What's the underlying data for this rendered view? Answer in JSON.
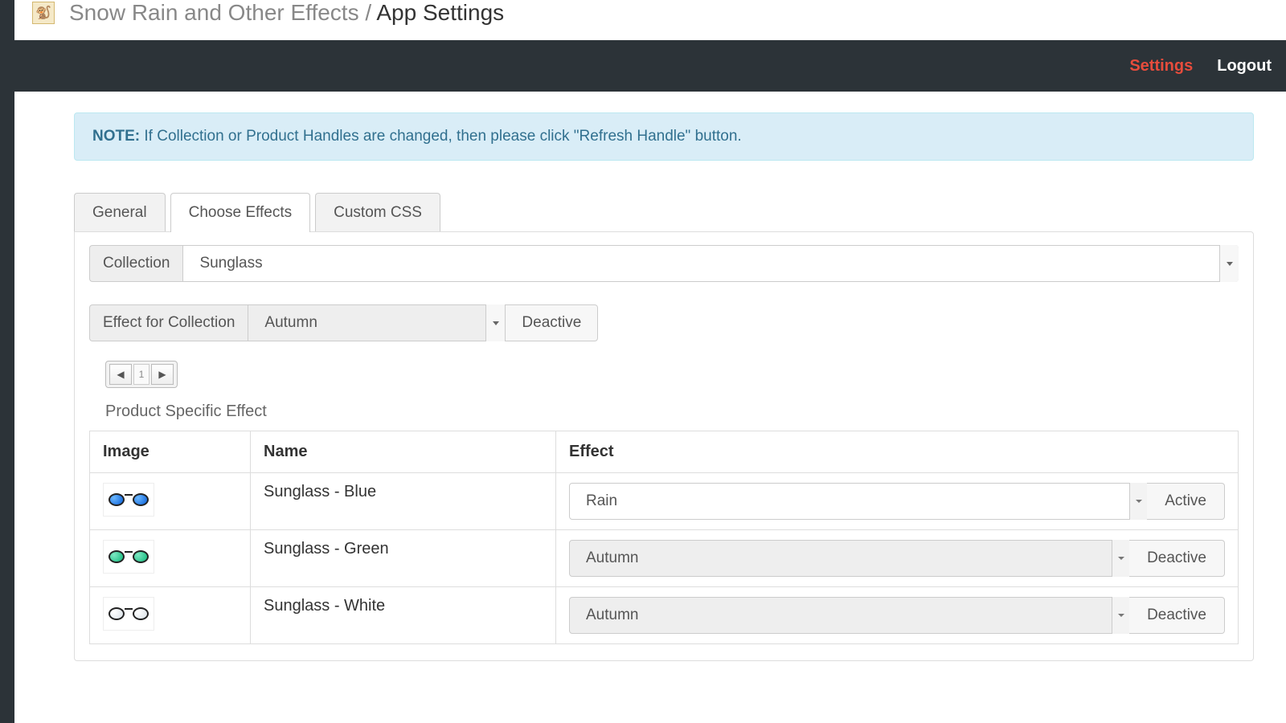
{
  "header": {
    "app_name": "Snow Rain and Other Effects",
    "separator": " / ",
    "page_name": "App Settings"
  },
  "nav": {
    "settings": "Settings",
    "logout": "Logout"
  },
  "note": {
    "label": "NOTE:",
    "text": " If Collection or Product Handles are changed, then please click \"Refresh Handle\" button."
  },
  "tabs": {
    "general": "General",
    "choose_effects": "Choose Effects",
    "custom_css": "Custom CSS"
  },
  "collection_row": {
    "label": "Collection",
    "value": "Sunglass"
  },
  "effect_row": {
    "label": "Effect for Collection",
    "value": "Autumn",
    "button": "Deactive"
  },
  "pager": {
    "prev": "◀",
    "page": "1",
    "next": "▶"
  },
  "section_title": "Product Specific Effect",
  "table": {
    "headers": {
      "image": "Image",
      "name": "Name",
      "effect": "Effect"
    },
    "rows": [
      {
        "name": "Sunglass - Blue",
        "effect": "Rain",
        "button": "Active",
        "disabled": false,
        "color": "blue"
      },
      {
        "name": "Sunglass - Green",
        "effect": "Autumn",
        "button": "Deactive",
        "disabled": true,
        "color": "green"
      },
      {
        "name": "Sunglass - White",
        "effect": "Autumn",
        "button": "Deactive",
        "disabled": true,
        "color": "white"
      }
    ]
  }
}
